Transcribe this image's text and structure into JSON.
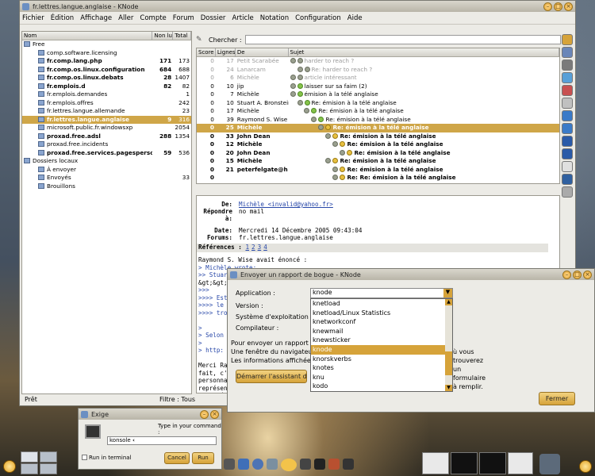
{
  "knode": {
    "title": "fr.lettres.langue.anglaise - KNode",
    "menu": [
      "Fichier",
      "Édition",
      "Affichage",
      "Aller",
      "Compte",
      "Forum",
      "Dossier",
      "Article",
      "Notation",
      "Configuration",
      "Aide"
    ],
    "folders_header": {
      "name": "Nom",
      "unread": "Non lus",
      "total": "Total"
    },
    "folders": [
      {
        "name": "Free",
        "unread": "",
        "total": "",
        "indent": 0,
        "bold": false
      },
      {
        "name": "comp.software.licensing",
        "unread": "",
        "total": "",
        "indent": 2,
        "bold": false
      },
      {
        "name": "fr.comp.lang.php",
        "unread": "171",
        "total": "173",
        "indent": 2,
        "bold": true
      },
      {
        "name": "fr.comp.os.linux.configuration",
        "unread": "684",
        "total": "688",
        "indent": 2,
        "bold": true
      },
      {
        "name": "fr.comp.os.linux.debats",
        "unread": "28",
        "total": "1407",
        "indent": 2,
        "bold": true
      },
      {
        "name": "fr.emplois.d",
        "unread": "82",
        "total": "82",
        "indent": 2,
        "bold": true
      },
      {
        "name": "fr.emplois.demandes",
        "unread": "",
        "total": "1",
        "indent": 2,
        "bold": false
      },
      {
        "name": "fr.emplois.offres",
        "unread": "",
        "total": "242",
        "indent": 2,
        "bold": false
      },
      {
        "name": "fr.lettres.langue.allemande",
        "unread": "",
        "total": "23",
        "indent": 2,
        "bold": false
      },
      {
        "name": "fr.lettres.langue.anglaise",
        "unread": "9",
        "total": "316",
        "indent": 2,
        "bold": true,
        "selected": true
      },
      {
        "name": "microsoft.public.fr.windowsxp",
        "unread": "",
        "total": "2054",
        "indent": 2,
        "bold": false
      },
      {
        "name": "proxad.free.adsl",
        "unread": "288",
        "total": "1354",
        "indent": 2,
        "bold": true
      },
      {
        "name": "proxad.free.incidents",
        "unread": "",
        "total": "",
        "indent": 2,
        "bold": false
      },
      {
        "name": "proxad.free.services.pagesperso",
        "unread": "59",
        "total": "536",
        "indent": 2,
        "bold": true
      },
      {
        "name": "Dossiers locaux",
        "unread": "",
        "total": "",
        "indent": 0,
        "bold": false
      },
      {
        "name": "À envoyer",
        "unread": "",
        "total": "",
        "indent": 2,
        "bold": false
      },
      {
        "name": "Envoyés",
        "unread": "",
        "total": "33",
        "indent": 2,
        "bold": false
      },
      {
        "name": "Brouillons",
        "unread": "",
        "total": "",
        "indent": 2,
        "bold": false
      }
    ],
    "search_label": "Chercher :",
    "articles_header": {
      "score": "Score",
      "lines": "Lignes",
      "from": "De",
      "subject": "Sujet"
    },
    "articles": [
      {
        "score": "0",
        "lines": "17",
        "from": "Petit Scarabée",
        "subject": "harder to reach ?",
        "depth": 0,
        "style": "grey"
      },
      {
        "score": "0",
        "lines": "24",
        "from": "Lanarcam",
        "subject": "Re: harder to reach ?",
        "depth": 1,
        "style": "grey"
      },
      {
        "score": "0",
        "lines": "6",
        "from": "Michèle",
        "subject": "article intéressant",
        "depth": 0,
        "style": "grey"
      },
      {
        "score": "0",
        "lines": "10",
        "from": "jip",
        "subject": "laisser sur sa faim (2)",
        "depth": 0,
        "style": "normal"
      },
      {
        "score": "0",
        "lines": "7",
        "from": "Michèle",
        "subject": "émision à la télé anglaise",
        "depth": 0,
        "style": "normal"
      },
      {
        "score": "0",
        "lines": "10",
        "from": "Stuart A. Bronstein",
        "subject": "Re: émision à la télé anglaise",
        "depth": 1,
        "style": "normal"
      },
      {
        "score": "0",
        "lines": "17",
        "from": "Michèle",
        "subject": "Re: émision à la télé anglaise",
        "depth": 2,
        "style": "normal"
      },
      {
        "score": "0",
        "lines": "39",
        "from": "Raymond S. Wise",
        "subject": "Re: émision à la télé anglaise",
        "depth": 3,
        "style": "normal"
      },
      {
        "score": "0",
        "lines": "25",
        "from": "Michèle",
        "subject": "Re: émision à la télé anglaise",
        "depth": 4,
        "style": "sel"
      },
      {
        "score": "0",
        "lines": "33",
        "from": "John Dean",
        "subject": "Re: émision à la télé anglaise",
        "depth": 5,
        "style": "bold"
      },
      {
        "score": "0",
        "lines": "12",
        "from": "Michèle",
        "subject": "Re: émision à la télé anglaise",
        "depth": 6,
        "style": "bold"
      },
      {
        "score": "0",
        "lines": "20",
        "from": "John Dean",
        "subject": "Re: émision à la télé anglaise",
        "depth": 7,
        "style": "bold"
      },
      {
        "score": "0",
        "lines": "15",
        "from": "Michèle",
        "subject": "Re: émision à la télé anglaise",
        "depth": 5,
        "style": "bold"
      },
      {
        "score": "0",
        "lines": "21",
        "from": "peterfelgate@ho...",
        "subject": "Re: émision à la télé anglaise",
        "depth": 6,
        "style": "bold"
      },
      {
        "score": "0",
        "lines": "",
        "from": "",
        "subject": "Re: Re: émision à la télé anglaise",
        "depth": 6,
        "style": "bold"
      }
    ],
    "headers": {
      "from_label": "De:",
      "from_value": "Michèle <invalid@yahoo.fr>",
      "reply_label": "Répondre à:",
      "reply_value": "no mail",
      "date_label": "Date:",
      "date_value": "Mercredi 14 Décembre 2005 09:43:04",
      "forums_label": "Forums:",
      "forums_value": "fr.lettres.langue.anglaise",
      "refs_label": "Références :",
      "refs": [
        "1",
        "2",
        "3",
        "4"
      ]
    },
    "body_lines": [
      "Raymond S. Wise avait énoncé :",
      "> Michèle wrote:",
      ">> Stuart",
      "&gt;&gt;&gt; \"Mich",
      ">>>",
      ">>>> Est",
      ">>>> le",
      ">>>> trou",
      "",
      ">",
      "> Selon V",
      ">",
      "> http:",
      "",
      "Merci Ray",
      "fait, c'e",
      "personnal",
      "représent",
      "Cette ém"
    ],
    "status": {
      "ready": "Prêt",
      "filter": "Filtre : Tous"
    }
  },
  "bug_dialog": {
    "title": "Envoyer un rapport de bogue - KNode",
    "application_label": "Application :",
    "application_value": "knode",
    "version_label": "Version :",
    "os_label": "Système d'exploitation :",
    "compiler_label": "Compilateur :",
    "info1": "Pour envoyer un rapport d",
    "info2": "Une fenêtre du navigateu",
    "info2_tail": "ù vous trouverez un formulaire à remplir.",
    "info3": "Les informations affichée",
    "start_button": "Démarrer l'assistant de",
    "dropdown_items": [
      "knetload",
      "knetload/Linux Statistics",
      "knetworkconf",
      "knewmail",
      "knewsticker",
      "knode",
      "knorskverbs",
      "knotes",
      "knu",
      "kodo"
    ],
    "dropdown_selected": "knode",
    "close_button": "Fermer"
  },
  "run_dialog": {
    "title": "Exige",
    "prompt": "Type in your command :",
    "command": "konsole",
    "run_in_terminal": "Run in terminal",
    "cancel": "Cancel",
    "run": "Run"
  }
}
